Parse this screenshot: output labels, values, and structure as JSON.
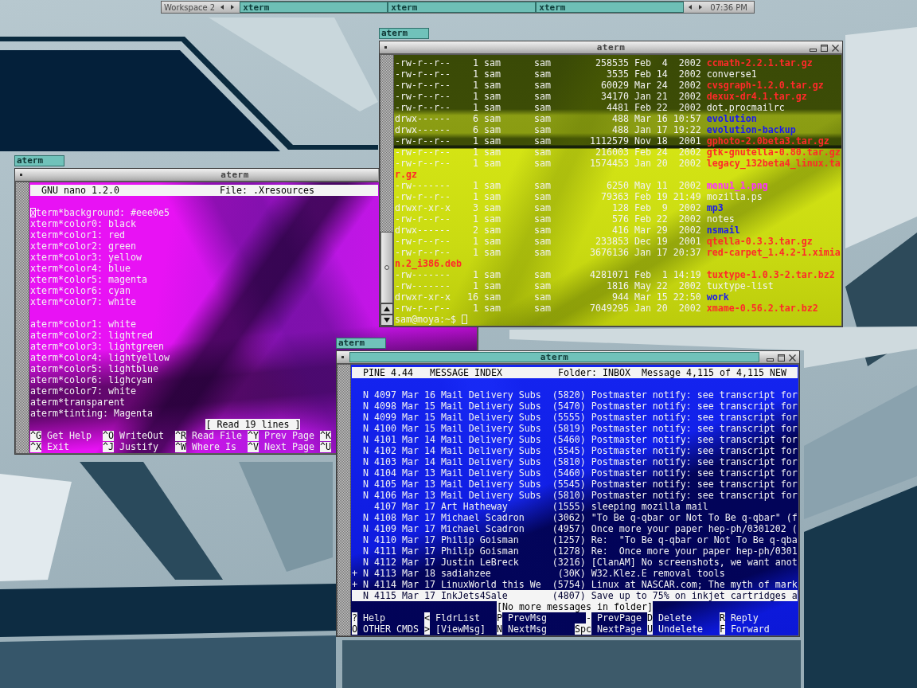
{
  "taskbar": {
    "workspace": "Workspace 2",
    "tasks": [
      {
        "label": "xterm"
      },
      {
        "label": "xterm"
      },
      {
        "label": "xterm"
      }
    ],
    "clock": "07:36 PM"
  },
  "listing_window": {
    "tab": "aterm",
    "title": "aterm",
    "active": false,
    "files": [
      {
        "permissions": "-rw-r--r--",
        "links": "1",
        "owner": "sam",
        "group": "sam",
        "size": "258535",
        "month": "Feb",
        "day": "4",
        "time": "2002",
        "name": "ccmath-2.2.1.tar.gz",
        "kind": "archive"
      },
      {
        "permissions": "-rw-r--r--",
        "links": "1",
        "owner": "sam",
        "group": "sam",
        "size": "3535",
        "month": "Feb",
        "day": "14",
        "time": "2002",
        "name": "converse1",
        "kind": "file"
      },
      {
        "permissions": "-rw-r--r--",
        "links": "1",
        "owner": "sam",
        "group": "sam",
        "size": "60029",
        "month": "Mar",
        "day": "24",
        "time": "2002",
        "name": "cvsgraph-1.2.0.tar.gz",
        "kind": "archive"
      },
      {
        "permissions": "-rw-r--r--",
        "links": "1",
        "owner": "sam",
        "group": "sam",
        "size": "34170",
        "month": "Jan",
        "day": "21",
        "time": "2002",
        "name": "dexux-dr4.1.tar.gz",
        "kind": "archive"
      },
      {
        "permissions": "-rw-r--r--",
        "links": "1",
        "owner": "sam",
        "group": "sam",
        "size": "4481",
        "month": "Feb",
        "day": "22",
        "time": "2002",
        "name": "dot.procmailrc",
        "kind": "file"
      },
      {
        "permissions": "drwx------",
        "links": "6",
        "owner": "sam",
        "group": "sam",
        "size": "488",
        "month": "Mar",
        "day": "16",
        "time": "10:57",
        "name": "evolution",
        "kind": "dir"
      },
      {
        "permissions": "drwx------",
        "links": "6",
        "owner": "sam",
        "group": "sam",
        "size": "488",
        "month": "Jan",
        "day": "17",
        "time": "19:22",
        "name": "evolution-backup",
        "kind": "dir"
      },
      {
        "permissions": "-rw-r--r--",
        "links": "1",
        "owner": "sam",
        "group": "sam",
        "size": "1112579",
        "month": "Nov",
        "day": "18",
        "time": "2001",
        "name": "gphoto-2.0beta3.tar.gz",
        "kind": "archive"
      },
      {
        "permissions": "-rw-r--r--",
        "links": "1",
        "owner": "sam",
        "group": "sam",
        "size": "216003",
        "month": "Feb",
        "day": "24",
        "time": "2002",
        "name": "gtk-gnutella-0.80.tar.gz",
        "kind": "archive"
      },
      {
        "permissions": "-rw-r--r--",
        "links": "1",
        "owner": "sam",
        "group": "sam",
        "size": "1574453",
        "month": "Jan",
        "day": "20",
        "time": "2002",
        "name": "legacy_132beta4_linux.ta",
        "wrapped_name": "r.gz",
        "kind": "archive"
      },
      {
        "permissions": "-rw-------",
        "links": "1",
        "owner": "sam",
        "group": "sam",
        "size": "6250",
        "month": "May",
        "day": "11",
        "time": "2002",
        "name": "menu1_1.png",
        "kind": "image"
      },
      {
        "permissions": "-rw-r--r--",
        "links": "1",
        "owner": "sam",
        "group": "sam",
        "size": "79363",
        "month": "Feb",
        "day": "19",
        "time": "21:49",
        "name": "mozilla.ps",
        "kind": "file"
      },
      {
        "permissions": "drwxr-xr-x",
        "links": "3",
        "owner": "sam",
        "group": "sam",
        "size": "128",
        "month": "Feb",
        "day": "9",
        "time": "2002",
        "name": "mp3",
        "kind": "dir"
      },
      {
        "permissions": "-rw-r--r--",
        "links": "1",
        "owner": "sam",
        "group": "sam",
        "size": "576",
        "month": "Feb",
        "day": "22",
        "time": "2002",
        "name": "notes",
        "kind": "file"
      },
      {
        "permissions": "drwx------",
        "links": "2",
        "owner": "sam",
        "group": "sam",
        "size": "416",
        "month": "Mar",
        "day": "29",
        "time": "2002",
        "name": "nsmail",
        "kind": "dir"
      },
      {
        "permissions": "-rw-r--r--",
        "links": "1",
        "owner": "sam",
        "group": "sam",
        "size": "233853",
        "month": "Dec",
        "day": "19",
        "time": "2001",
        "name": "qtella-0.3.3.tar.gz",
        "kind": "archive"
      },
      {
        "permissions": "-rw-r--r--",
        "links": "1",
        "owner": "sam",
        "group": "sam",
        "size": "3676136",
        "month": "Jan",
        "day": "17",
        "time": "20:37",
        "name": "red-carpet_1.4.2-1.ximia",
        "wrapped_name": "n.2_i386.deb",
        "kind": "archive"
      },
      {
        "permissions": "-rw-------",
        "links": "1",
        "owner": "sam",
        "group": "sam",
        "size": "4281071",
        "month": "Feb",
        "day": "1",
        "time": "14:19",
        "name": "tuxtype-1.0.3-2.tar.bz2",
        "kind": "archive"
      },
      {
        "permissions": "-rw-------",
        "links": "1",
        "owner": "sam",
        "group": "sam",
        "size": "1816",
        "month": "May",
        "day": "22",
        "time": "2002",
        "name": "tuxtype-list",
        "kind": "file"
      },
      {
        "permissions": "drwxr-xr-x",
        "links": "16",
        "owner": "sam",
        "group": "sam",
        "size": "944",
        "month": "Mar",
        "day": "15",
        "time": "22:50",
        "name": "work",
        "kind": "dir"
      },
      {
        "permissions": "-rw-r--r--",
        "links": "1",
        "owner": "sam",
        "group": "sam",
        "size": "7049295",
        "month": "Jan",
        "day": "20",
        "time": "2002",
        "name": "xmame-0.56.2.tar.bz2",
        "kind": "archive"
      }
    ],
    "prompt": "sam@moya:~$",
    "cursor": true
  },
  "editor_window": {
    "tab": "aterm",
    "title": "aterm",
    "active": false,
    "header": {
      "version": "GNU nano 1.2.0",
      "file": "File: .Xresources"
    },
    "blocks": [
      {
        "lines": [
          {
            "text": "xterm*background: #eee0e5",
            "cursor": true
          },
          {
            "text": "xterm*color0: black",
            "cursor": false
          },
          {
            "text": "xterm*color1: red",
            "cursor": false
          },
          {
            "text": "xterm*color2: green",
            "cursor": false
          },
          {
            "text": "xterm*color3: yellow",
            "cursor": false
          },
          {
            "text": "xterm*color4: blue",
            "cursor": false
          },
          {
            "text": "xterm*color5: magenta",
            "cursor": false
          },
          {
            "text": "xterm*color6: cyan",
            "cursor": false
          },
          {
            "text": "xterm*color7: white",
            "cursor": false
          }
        ]
      },
      {
        "lines": [
          {
            "text": "aterm*color1: white",
            "cursor": false
          },
          {
            "text": "aterm*color2: lightred",
            "cursor": false
          },
          {
            "text": "aterm*color3: lightgreen",
            "cursor": false
          },
          {
            "text": "aterm*color4: lightyellow",
            "cursor": false
          },
          {
            "text": "aterm*color5: lightblue",
            "cursor": false
          },
          {
            "text": "aterm*color6: lighcyan",
            "cursor": false
          },
          {
            "text": "aterm*color7: white",
            "cursor": false
          },
          {
            "text": "aterm*transparent",
            "cursor": false
          },
          {
            "text": "aterm*tinting: Magenta",
            "cursor": false
          }
        ]
      }
    ],
    "status": "[ Read 19 lines ]",
    "shortcuts": [
      {
        "key": "^G",
        "label": "Get Help"
      },
      {
        "key": "^O",
        "label": "WriteOut"
      },
      {
        "key": "^R",
        "label": "Read File"
      },
      {
        "key": "^Y",
        "label": "Prev Page"
      },
      {
        "key": "^K"
      },
      {
        "key": "^X",
        "label": "Exit"
      },
      {
        "key": "^J",
        "label": "Justify"
      },
      {
        "key": "^W",
        "label": "Where Is"
      },
      {
        "key": "^V",
        "label": "Next Page"
      },
      {
        "key": "^U"
      }
    ]
  },
  "mail_window": {
    "tab": "aterm",
    "title": "aterm",
    "active": true,
    "header": {
      "version": "PINE 4.44",
      "screen": "MESSAGE INDEX",
      "folder": "Folder: INBOX",
      "count": "Message 4,115 of 4,115 NEW"
    },
    "messages": [
      {
        "status": "N",
        "number": "4097",
        "date": "Mar 16",
        "from": "Mail Delivery Subs",
        "size": "(5820)",
        "subject": "Postmaster notify: see transcript for",
        "selected": false
      },
      {
        "status": "N",
        "number": "4098",
        "date": "Mar 15",
        "from": "Mail Delivery Subs",
        "size": "(5470)",
        "subject": "Postmaster notify: see transcript for",
        "selected": false
      },
      {
        "status": "N",
        "number": "4099",
        "date": "Mar 15",
        "from": "Mail Delivery Subs",
        "size": "(5555)",
        "subject": "Postmaster notify: see transcript for",
        "selected": false
      },
      {
        "status": "N",
        "number": "4100",
        "date": "Mar 15",
        "from": "Mail Delivery Subs",
        "size": "(5819)",
        "subject": "Postmaster notify: see transcript for",
        "selected": false
      },
      {
        "status": "N",
        "number": "4101",
        "date": "Mar 14",
        "from": "Mail Delivery Subs",
        "size": "(5460)",
        "subject": "Postmaster notify: see transcript for",
        "selected": false
      },
      {
        "status": "N",
        "number": "4102",
        "date": "Mar 14",
        "from": "Mail Delivery Subs",
        "size": "(5545)",
        "subject": "Postmaster notify: see transcript for",
        "selected": false
      },
      {
        "status": "N",
        "number": "4103",
        "date": "Mar 14",
        "from": "Mail Delivery Subs",
        "size": "(5810)",
        "subject": "Postmaster notify: see transcript for",
        "selected": false
      },
      {
        "status": "N",
        "number": "4104",
        "date": "Mar 13",
        "from": "Mail Delivery Subs",
        "size": "(5460)",
        "subject": "Postmaster notify: see transcript for",
        "selected": false
      },
      {
        "status": "N",
        "number": "4105",
        "date": "Mar 13",
        "from": "Mail Delivery Subs",
        "size": "(5545)",
        "subject": "Postmaster notify: see transcript for",
        "selected": false
      },
      {
        "status": "N",
        "number": "4106",
        "date": "Mar 13",
        "from": "Mail Delivery Subs",
        "size": "(5810)",
        "subject": "Postmaster notify: see transcript for",
        "selected": false
      },
      {
        "number": "4107",
        "date": "Mar 17",
        "from": "Art Hatheway",
        "size": "(1555)",
        "subject": "sleeping mozilla mail",
        "selected": false
      },
      {
        "status": "N",
        "number": "4108",
        "date": "Mar 17",
        "from": "Michael Scadron",
        "size": "(3062)",
        "subject": "\"To Be q-qbar or Not To Be q-qbar\" (f",
        "selected": false
      },
      {
        "status": "N",
        "number": "4109",
        "date": "Mar 17",
        "from": "Michael Scadron",
        "size": "(4957)",
        "subject": "Once more your paper hep-ph/0301202 (",
        "selected": false
      },
      {
        "status": "N",
        "number": "4110",
        "date": "Mar 17",
        "from": "Philip Goisman",
        "size": "(1257)",
        "subject": "Re:  \"To Be q-qbar or Not To Be q-qba",
        "selected": false
      },
      {
        "status": "N",
        "number": "4111",
        "date": "Mar 17",
        "from": "Philip Goisman",
        "size": "(1278)",
        "subject": "Re:  Once more your paper hep-ph/0301",
        "selected": false
      },
      {
        "status": "N",
        "number": "4112",
        "date": "Mar 17",
        "from": "Justin LeBreck",
        "size": "(3216)",
        "subject": "[ClanAM] No screenshots, we want anot",
        "selected": false
      },
      {
        "flag": "+",
        "status": "N",
        "number": "4113",
        "date": "Mar 18",
        "from": "sadiahzee",
        "size": "(30K)",
        "subject": "W32.Klez.E removal tools",
        "selected": false
      },
      {
        "flag": "+",
        "status": "N",
        "number": "4114",
        "date": "Mar 17",
        "from": "LinuxWorld this We",
        "size": "(5754)",
        "subject": "Linux at NASCAR.com; The myth of mark",
        "selected": false
      },
      {
        "status": "N",
        "number": "4115",
        "date": "Mar 17",
        "from": "InkJets4Sale",
        "size": "(4807)",
        "subject": "Save up to 75% on inkjet cartridges a",
        "selected": true
      }
    ],
    "status": "[No more messages in folder]",
    "commands": [
      {
        "key": "?",
        "label": "Help"
      },
      {
        "key": "<",
        "label": "FldrList"
      },
      {
        "key": "P",
        "label": "PrevMsg"
      },
      {
        "key": "-",
        "label": "PrevPage"
      },
      {
        "key": "D",
        "label": "Delete"
      },
      {
        "key": "R",
        "label": "Reply"
      },
      {
        "key": "O",
        "label": "OTHER CMDS"
      },
      {
        "key": ">",
        "label": "[ViewMsg]"
      },
      {
        "key": "N",
        "label": "NextMsg"
      },
      {
        "key": "Spc",
        "label": "NextPage"
      },
      {
        "key": "U",
        "label": "Undelete"
      },
      {
        "key": "F",
        "label": "Forward"
      }
    ]
  }
}
